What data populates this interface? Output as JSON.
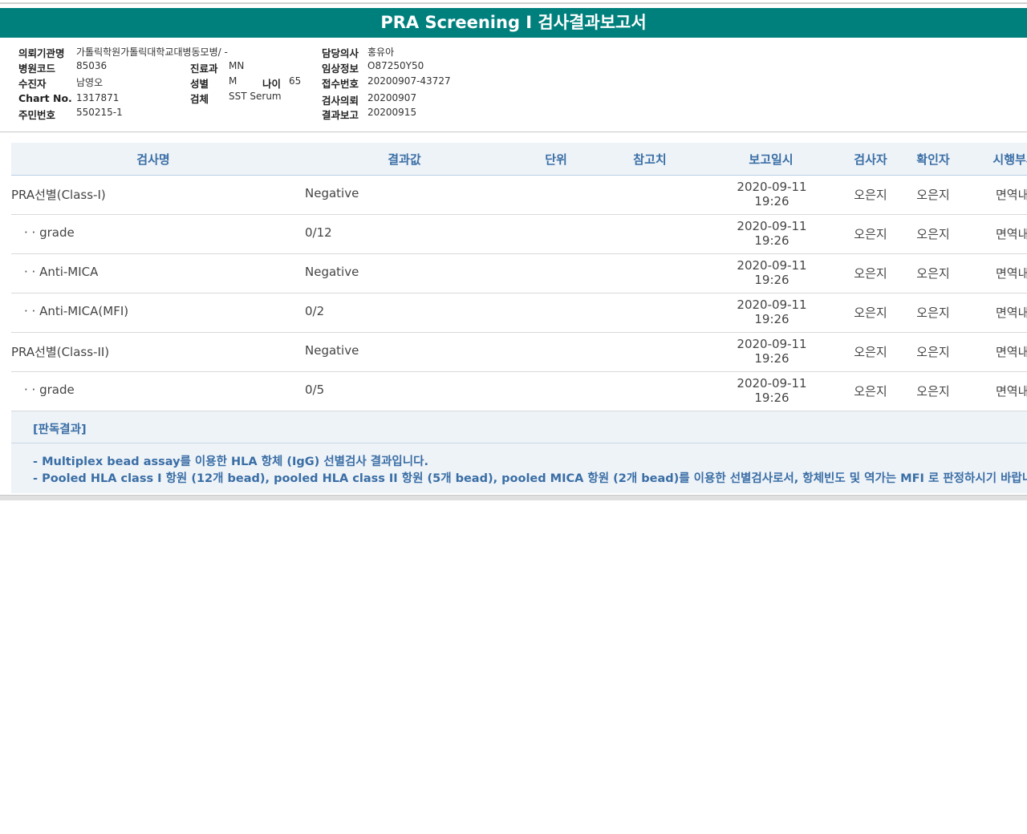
{
  "report": {
    "title": "PRA Screening I 검사결과보고서"
  },
  "info": {
    "hospital_label": "의뢰기관명",
    "hospital_value": "가톨릭학원가톨릭대학교대병동모병/ -",
    "hospital_code_label": "병원코드",
    "hospital_code_value": "85036",
    "patient_label": "수진자",
    "patient_value": "남영오",
    "chart_label": "Chart No.",
    "chart_value": "1317871",
    "rrn_label": "주민번호",
    "rrn_value": "550215-1",
    "dept_label": "진료과",
    "dept_value": "MN",
    "sex_label": "성별",
    "sex_value": "M",
    "age_label": "나이",
    "age_value": "65",
    "specimen_label": "검체",
    "specimen_value": "SST Serum",
    "doctor_label": "담당의사",
    "doctor_value": "홍유아",
    "clinical_label": "임상정보",
    "clinical_value": "O87250Y50",
    "receipt_label": "접수번호",
    "receipt_value": "20200907-43727",
    "request_label": "검사의뢰",
    "request_value": "20200907",
    "report_label": "결과보고",
    "report_value": "20200915"
  },
  "table": {
    "headers": {
      "name": "검사명",
      "result": "결과값",
      "unit": "단위",
      "ref": "참고치",
      "report_date": "보고일시",
      "tester": "검사자",
      "verifier": "확인자",
      "dept": "시행부서"
    },
    "rows": [
      {
        "name": "PRA선별(Class-I)",
        "result": "Negative",
        "date": "2020-09-11",
        "time": "19:26",
        "tester": "오은지",
        "verifier": "오은지",
        "dept": "면역내과"
      },
      {
        "name": "· · grade",
        "result": "0/12",
        "date": "2020-09-11",
        "time": "19:26",
        "tester": "오은지",
        "verifier": "오은지",
        "dept": "면역내과"
      },
      {
        "name": "· · Anti-MICA",
        "result": "Negative",
        "date": "2020-09-11",
        "time": "19:26",
        "tester": "오은지",
        "verifier": "오은지",
        "dept": "면역내과"
      },
      {
        "name": "· · Anti-MICA(MFI)",
        "result": "0/2",
        "date": "2020-09-11",
        "time": "19:26",
        "tester": "오은지",
        "verifier": "오은지",
        "dept": "면역내과"
      },
      {
        "name": "PRA선별(Class-II)",
        "result": "Negative",
        "date": "2020-09-11",
        "time": "19:26",
        "tester": "오은지",
        "verifier": "오은지",
        "dept": "면역내과"
      },
      {
        "name": "· · grade",
        "result": "0/5",
        "date": "2020-09-11",
        "time": "19:26",
        "tester": "오은지",
        "verifier": "오은지",
        "dept": "면역내과"
      }
    ]
  },
  "judgment": {
    "title": "[판독결과]",
    "line1": "- Multiplex bead assay를 이용한 HLA 항체 (IgG) 선별검사 결과입니다.",
    "line2": "- Pooled HLA class I 항원 (12개 bead), pooled HLA class II 항원 (5개 bead), pooled MICA 항원 (2개 bead)를 이용한 선별검사로서, 항체빈도 및 역가는 MFI 로 판정하시기 바랍니다."
  }
}
